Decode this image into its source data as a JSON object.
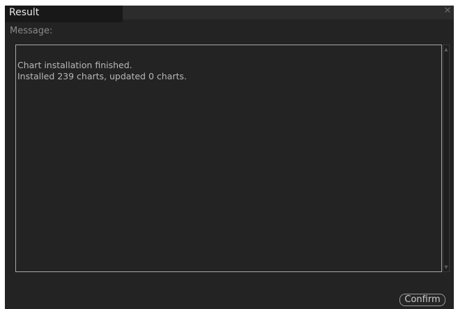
{
  "dialog": {
    "title": "Result",
    "close_icon": "close-icon",
    "message_label": "Message:",
    "message_lines": [
      "Chart installation finished.",
      "Installed 239 charts, updated 0 charts."
    ],
    "confirm_label": "Confirm"
  },
  "colors": {
    "background": "#232323",
    "title_tab": "#181818",
    "text": "#b8b8b8",
    "border": "#a9a9a9"
  }
}
